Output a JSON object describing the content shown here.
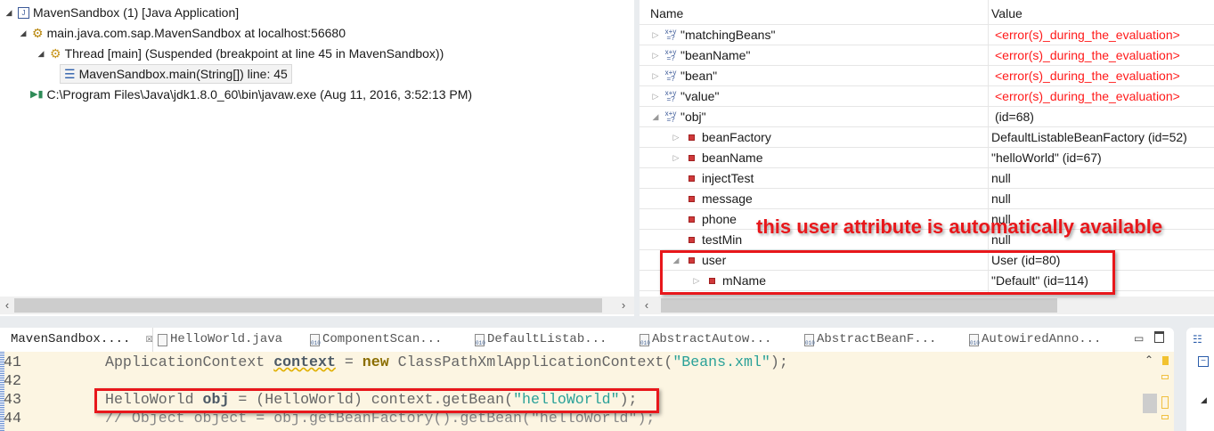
{
  "debug_tree": [
    {
      "label": "MavenSandbox (1) [Java Application]",
      "icon": "java-app-icon"
    },
    {
      "label": "main.java.com.sap.MavenSandbox at localhost:56680",
      "icon": "debug-target-icon"
    },
    {
      "label": "Thread [main] (Suspended (breakpoint at line 45 in MavenSandbox))",
      "icon": "thread-icon"
    },
    {
      "label": "MavenSandbox.main(String[]) line: 45",
      "icon": "stack-frame-icon"
    },
    {
      "label": "C:\\Program Files\\Java\\jdk1.8.0_60\\bin\\javaw.exe (Aug 11, 2016, 3:52:13 PM)",
      "icon": "process-icon"
    }
  ],
  "variables": {
    "headers": {
      "name": "Name",
      "value": "Value"
    },
    "rows": [
      {
        "name": "\"matchingBeans\"",
        "value": "<error(s)_during_the_evaluation>",
        "kind": "expr"
      },
      {
        "name": "\"beanName\"",
        "value": "<error(s)_during_the_evaluation>",
        "kind": "expr"
      },
      {
        "name": "\"bean\"",
        "value": "<error(s)_during_the_evaluation>",
        "kind": "expr"
      },
      {
        "name": "\"value\"",
        "value": "<error(s)_during_the_evaluation>",
        "kind": "expr"
      },
      {
        "name": "\"obj\"",
        "value": "(id=68)",
        "kind": "expr"
      },
      {
        "name": "beanFactory",
        "value": "DefaultListableBeanFactory  (id=52)",
        "kind": "field"
      },
      {
        "name": "beanName",
        "value": "\"helloWorld\" (id=67)",
        "kind": "field"
      },
      {
        "name": "injectTest",
        "value": "null",
        "kind": "field"
      },
      {
        "name": "message",
        "value": "null",
        "kind": "field"
      },
      {
        "name": "phone",
        "value": "null",
        "kind": "field"
      },
      {
        "name": "testMin",
        "value": "null",
        "kind": "field"
      },
      {
        "name": "user",
        "value": "User  (id=80)",
        "kind": "field"
      },
      {
        "name": "mName",
        "value": "\"Default\" (id=114)",
        "kind": "field"
      }
    ]
  },
  "annotation": "this user attribute is automatically available",
  "editor": {
    "tabs": [
      "MavenSandbox....",
      "HelloWorld.java",
      "ComponentScan...",
      "DefaultListab...",
      "AbstractAutow...",
      "AbstractBeanF...",
      "AutowiredAnno..."
    ],
    "close_glyph": "☒",
    "lines": [
      {
        "num": "41",
        "a": "ApplicationContext ",
        "b": "context",
        "c": " = ",
        "d": "new",
        "e": " ClassPathXmlApplicationContext(",
        "f": "\"Beans.xml\"",
        "g": ");"
      },
      {
        "num": "42"
      },
      {
        "num": "43",
        "a": "HelloWorld ",
        "b": "obj",
        "c": " = (HelloWorld) context.getBean(",
        "f": "\"helloWorld\"",
        "g": ");"
      },
      {
        "num": "44",
        "a": "// Object object = obj.getBeanFactory().getBean(\"helloWorld\");"
      }
    ]
  },
  "colors": {
    "error": "#ff1a1a",
    "annotation": "#e8171b",
    "editor_bg": "#fcf5e2"
  }
}
